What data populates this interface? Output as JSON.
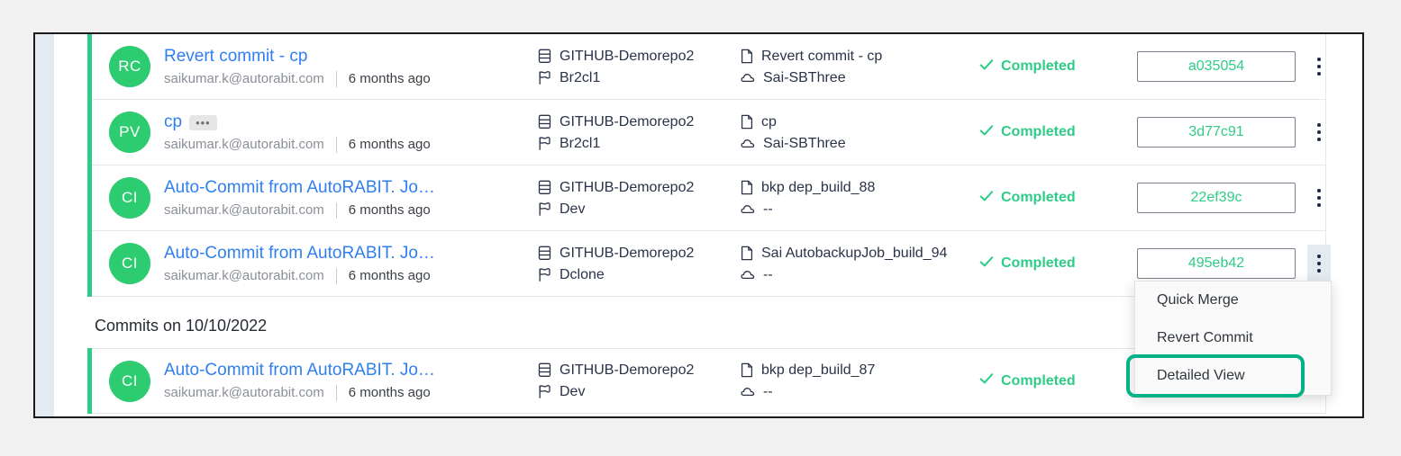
{
  "theme": {
    "accent_green": "#2ecc86",
    "link_blue": "#2f7ff0",
    "highlight_green": "#05b285",
    "avatar_green": "#2ecc71",
    "status_green": "#2ecc86"
  },
  "groups": [
    {
      "date_header": null,
      "rows": [
        {
          "avatar_initials": "RC",
          "title": "Revert commit - cp",
          "has_expand_badge": false,
          "expand_badge_label": "",
          "author": "saikumar.k@autorabit.com",
          "time": "6 months ago",
          "repo": "GITHUB-Demorepo2",
          "branch": "Br2cl1",
          "job": "Revert commit - cp",
          "org": "Sai-SBThree",
          "status": "Completed",
          "hash": "a035054",
          "kebab_active": false
        },
        {
          "avatar_initials": "PV",
          "title": "cp",
          "has_expand_badge": true,
          "expand_badge_label": "•••",
          "author": "saikumar.k@autorabit.com",
          "time": "6 months ago",
          "repo": "GITHUB-Demorepo2",
          "branch": "Br2cl1",
          "job": "cp",
          "org": "Sai-SBThree",
          "status": "Completed",
          "hash": "3d77c91",
          "kebab_active": false
        },
        {
          "avatar_initials": "CI",
          "title": "Auto-Commit from AutoRABIT. Jo…",
          "has_expand_badge": false,
          "expand_badge_label": "",
          "author": "saikumar.k@autorabit.com",
          "time": "6 months ago",
          "repo": "GITHUB-Demorepo2",
          "branch": "Dev",
          "job": "bkp dep_build_88",
          "org": "--",
          "status": "Completed",
          "hash": "22ef39c",
          "kebab_active": false
        },
        {
          "avatar_initials": "CI",
          "title": "Auto-Commit from AutoRABIT. Jo…",
          "has_expand_badge": false,
          "expand_badge_label": "",
          "author": "saikumar.k@autorabit.com",
          "time": "6 months ago",
          "repo": "GITHUB-Demorepo2",
          "branch": "Dclone",
          "job": "Sai AutobackupJob_build_94",
          "org": "--",
          "status": "Completed",
          "hash": "495eb42",
          "kebab_active": true
        }
      ]
    },
    {
      "date_header": "Commits on 10/10/2022",
      "rows": [
        {
          "avatar_initials": "CI",
          "title": "Auto-Commit from AutoRABIT. Jo…",
          "has_expand_badge": false,
          "expand_badge_label": "",
          "author": "saikumar.k@autorabit.com",
          "time": "6 months ago",
          "repo": "GITHUB-Demorepo2",
          "branch": "Dev",
          "job": "bkp dep_build_87",
          "org": "--",
          "status": "Completed",
          "hash": "",
          "kebab_active": false
        }
      ]
    }
  ],
  "dropdown": {
    "visible": true,
    "items": [
      {
        "label": "Quick Merge",
        "highlighted": false
      },
      {
        "label": "Revert Commit",
        "highlighted": false
      },
      {
        "label": "Detailed View",
        "highlighted": true
      }
    ]
  },
  "icons": {
    "repo": "database-icon",
    "branch": "flag-icon",
    "job": "file-icon",
    "org": "cloud-icon",
    "status": "check-icon",
    "kebab": "kebab-menu-icon"
  }
}
